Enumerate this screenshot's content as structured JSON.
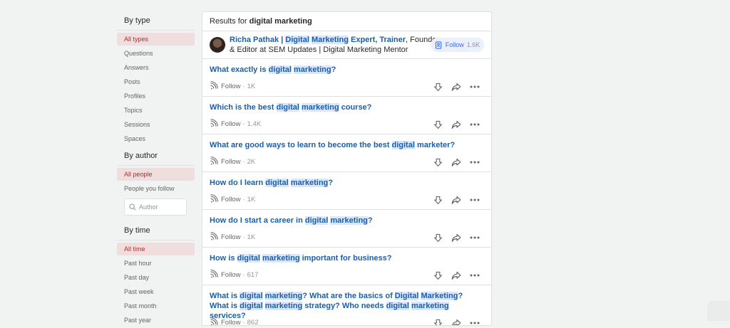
{
  "sidebar": {
    "by_type": {
      "title": "By type",
      "items": [
        "All types",
        "Questions",
        "Answers",
        "Posts",
        "Profiles",
        "Topics",
        "Sessions",
        "Spaces"
      ]
    },
    "by_author": {
      "title": "By author",
      "items": [
        "All people",
        "People you follow"
      ],
      "author_placeholder": "Author"
    },
    "by_time": {
      "title": "By time",
      "items": [
        "All time",
        "Past hour",
        "Past day",
        "Past week",
        "Past month",
        "Past year"
      ]
    }
  },
  "results": {
    "prefix": "Results for",
    "query": "digital marketing"
  },
  "person": {
    "name_parts": [
      "Richa Pathak | ",
      "Digital",
      " ",
      "Marketing",
      " Expert, Trainer"
    ],
    "rest": ", Founder & Editor at SEM Updates | Digital Marketing Mentor",
    "follow_label": "Follow",
    "follow_count": "1.6K"
  },
  "questions": [
    {
      "parts": [
        [
          "What exactly is ",
          0
        ],
        [
          "digital",
          1
        ],
        [
          " ",
          0
        ],
        [
          "marketing",
          1
        ],
        [
          "?",
          0
        ]
      ],
      "followers": "1K"
    },
    {
      "parts": [
        [
          "Which is the best ",
          0
        ],
        [
          "digital",
          1
        ],
        [
          " ",
          0
        ],
        [
          "marketing",
          1
        ],
        [
          " course?",
          0
        ]
      ],
      "followers": "1.4K"
    },
    {
      "parts": [
        [
          "What are good ways to learn to become the best ",
          0
        ],
        [
          "digital",
          1
        ],
        [
          " marketer?",
          0
        ]
      ],
      "followers": "2K"
    },
    {
      "parts": [
        [
          "How do I learn ",
          0
        ],
        [
          "digital",
          1
        ],
        [
          " ",
          0
        ],
        [
          "marketing",
          1
        ],
        [
          "?",
          0
        ]
      ],
      "followers": "1K"
    },
    {
      "parts": [
        [
          "How do I start a career in ",
          0
        ],
        [
          "digital",
          1
        ],
        [
          " ",
          0
        ],
        [
          "marketing",
          1
        ],
        [
          "?",
          0
        ]
      ],
      "followers": "1K"
    },
    {
      "parts": [
        [
          "How is ",
          0
        ],
        [
          "digital",
          1
        ],
        [
          " ",
          0
        ],
        [
          "marketing",
          1
        ],
        [
          " important for business?",
          0
        ]
      ],
      "followers": "617"
    },
    {
      "parts": [
        [
          "What is ",
          0
        ],
        [
          "digital",
          1
        ],
        [
          " ",
          0
        ],
        [
          "marketing",
          1
        ],
        [
          "? What are the basics of ",
          0
        ],
        [
          "Digital",
          1
        ],
        [
          " ",
          0
        ],
        [
          "Marketing",
          1
        ],
        [
          "? What is ",
          0
        ],
        [
          "digital",
          1
        ],
        [
          " ",
          0
        ],
        [
          "marketing",
          1
        ],
        [
          " strategy? Who needs ",
          0
        ],
        [
          "digital",
          1
        ],
        [
          " ",
          0
        ],
        [
          "marketing",
          1
        ],
        [
          " services?",
          0
        ]
      ],
      "followers": "862"
    }
  ],
  "follow_label": "Follow",
  "separator": "·"
}
